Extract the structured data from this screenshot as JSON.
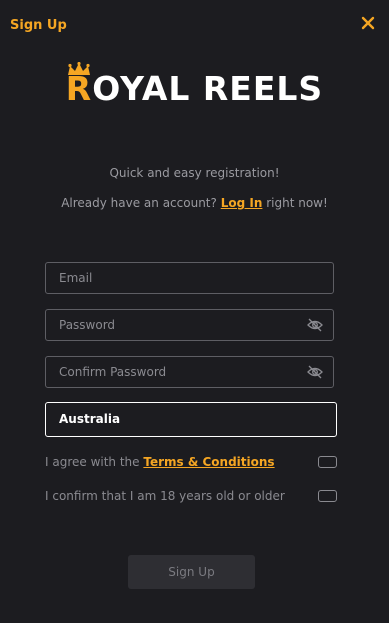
{
  "header": {
    "title": "Sign Up",
    "close_icon": "close-icon"
  },
  "logo": {
    "text_first": "R",
    "text_rest": "OYAL REELS",
    "icon": "crown-icon"
  },
  "intro": {
    "tagline": "Quick and easy registration!",
    "login_prefix": "Already have an account?",
    "login_link": "Log In",
    "login_suffix": "right now!"
  },
  "form": {
    "email_placeholder": "Email",
    "password_placeholder": "Password",
    "confirm_password_placeholder": "Confirm Password",
    "country": "Australia",
    "terms_prefix": "I agree with the",
    "terms_link": "Terms & Conditions",
    "age_confirm": "I confirm that I am 18 years old or older",
    "submit_label": "Sign Up"
  },
  "colors": {
    "accent": "#f5a623",
    "background": "#1c1c20"
  }
}
